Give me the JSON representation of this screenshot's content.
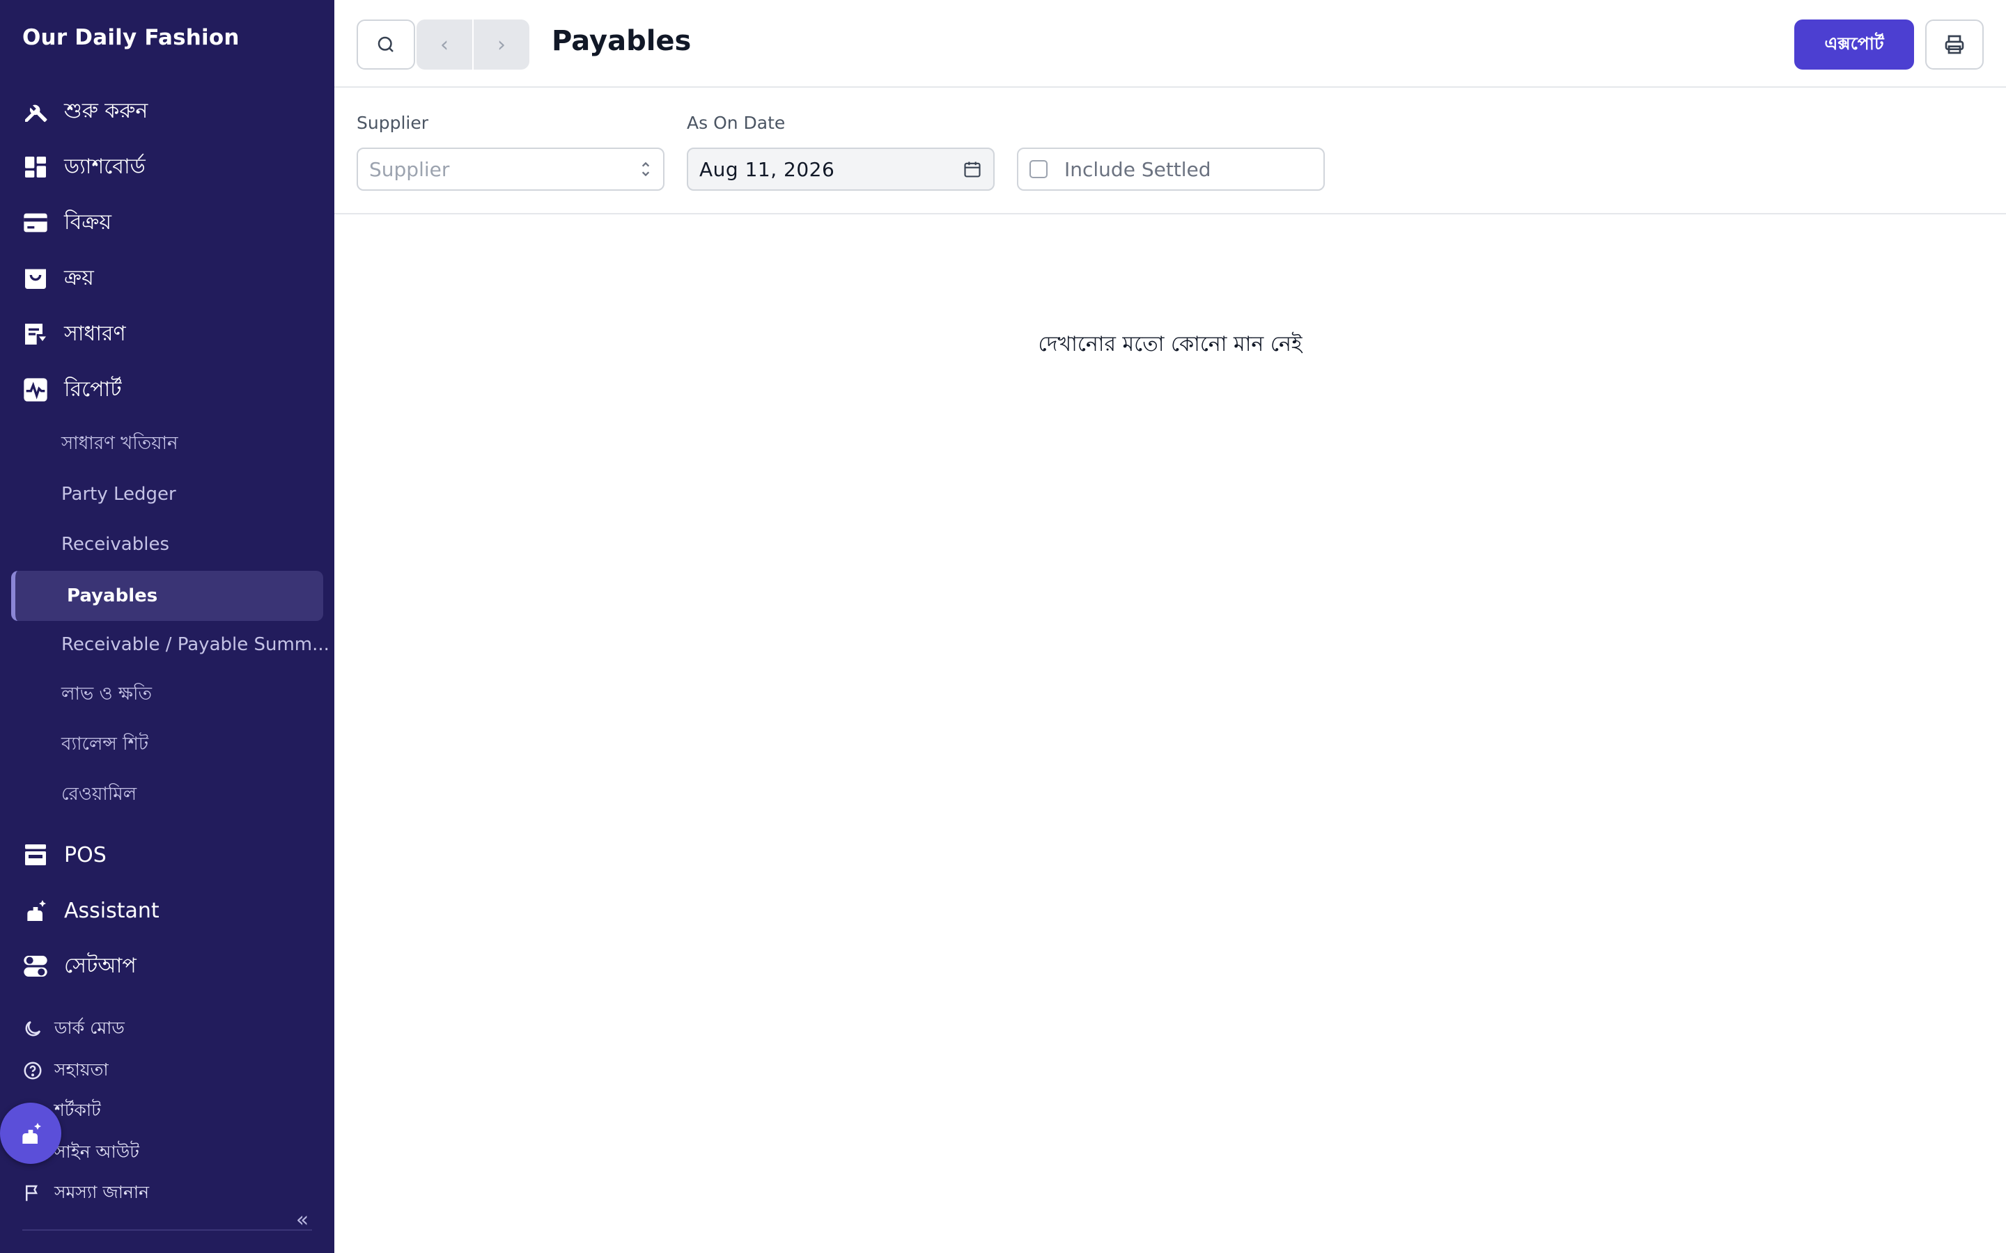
{
  "sidebar": {
    "brand": "Our Daily Fashion",
    "nav": [
      {
        "label": "শুরু করুন",
        "icon": "tools-icon"
      },
      {
        "label": "ড্যাশবোর্ড",
        "icon": "dashboard-icon"
      },
      {
        "label": "বিক্রয়",
        "icon": "sales-card-icon"
      },
      {
        "label": "ক্রয়",
        "icon": "shopping-bag-icon"
      },
      {
        "label": "সাধারণ",
        "icon": "journal-icon"
      },
      {
        "label": "রিপোর্ট",
        "icon": "report-pulse-icon"
      }
    ],
    "report_sub": [
      "সাধারণ খতিয়ান",
      "Party Ledger",
      "Receivables",
      "Payables",
      "Receivable / Payable Summ...",
      "লাভ ও ক্ষতি",
      "ব্যালেন্স শিট",
      "রেওয়ামিল"
    ],
    "nav_bottom": [
      {
        "label": "POS",
        "icon": "pos-store-icon"
      },
      {
        "label": "Assistant",
        "icon": "assistant-sparkle-icon"
      },
      {
        "label": "সেটআপ",
        "icon": "setup-toggle-icon"
      }
    ],
    "footer": [
      {
        "label": "ডার্ক মোড",
        "icon": "moon-icon"
      },
      {
        "label": "সহায়তা",
        "icon": "help-circle-icon"
      },
      {
        "label": "শর্টকাট",
        "icon": "shortcut-icon"
      },
      {
        "label": "সাইন আউট",
        "icon": "sign-out-icon"
      },
      {
        "label": "সমস্যা জানান",
        "icon": "flag-icon"
      }
    ],
    "collapse_glyph": "«",
    "accent": "#221c5c"
  },
  "toolbar": {
    "title": "Payables",
    "export_label": "এক্সপোর্ট",
    "prev_glyph": "‹",
    "next_glyph": "›"
  },
  "filters": {
    "supplier_label": "Supplier",
    "supplier_placeholder": "Supplier",
    "date_label": "As On Date",
    "date_value": "Aug 11, 2026",
    "include_settled_label": "Include Settled"
  },
  "main": {
    "empty_message": "দেখানোর মতো কোনো মান নেই"
  },
  "colors": {
    "primary": "#4c3fd1",
    "sidebar_bg": "#221c5c",
    "active_item_bg": "#3a3475"
  }
}
